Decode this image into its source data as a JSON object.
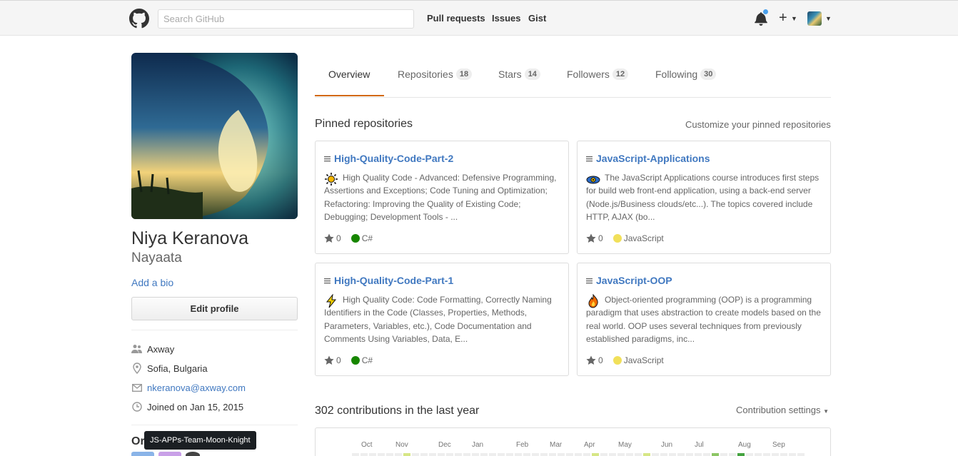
{
  "header": {
    "search_placeholder": "Search GitHub",
    "nav": [
      "Pull requests",
      "Issues",
      "Gist"
    ]
  },
  "profile": {
    "full_name": "Niya Keranova",
    "username": "Nayaata",
    "add_bio": "Add a bio",
    "edit_profile": "Edit profile",
    "details": {
      "company": "Axway",
      "location": "Sofia, Bulgaria",
      "email": "nkeranova@axway.com",
      "joined": "Joined on Jan 15, 2015"
    },
    "organizations_title": "Organizations",
    "tooltip": "JS-APPs-Team-Moon-Knight"
  },
  "tabs": [
    {
      "label": "Overview",
      "count": ""
    },
    {
      "label": "Repositories",
      "count": "18"
    },
    {
      "label": "Stars",
      "count": "14"
    },
    {
      "label": "Followers",
      "count": "12"
    },
    {
      "label": "Following",
      "count": "30"
    }
  ],
  "pinned": {
    "title": "Pinned repositories",
    "customize": "Customize your pinned repositories",
    "repos": [
      {
        "name": "High-Quality-Code-Part-2",
        "emoji": "sun-emoji",
        "description": "High Quality Code - Advanced: Defensive Programming, Assertions and Exceptions; Code Tuning and Optimization; Refactoring: Improving the Quality of Existing Code; Debugging; Development Tools - ...",
        "stars": "0",
        "language": "C#",
        "language_color": "#178600"
      },
      {
        "name": "JavaScript-Applications",
        "emoji": "eye-emoji",
        "description": "The JavaScript Applications course introduces first steps for build web front-end application, using a back-end server (Node.js/Business clouds/etc...). The topics covered include HTTP, AJAX (bo...",
        "stars": "0",
        "language": "JavaScript",
        "language_color": "#f1e05a"
      },
      {
        "name": "High-Quality-Code-Part-1",
        "emoji": "zap-emoji",
        "description": "High Quality Code: Code Formatting, Correctly Naming Identifiers in the Code (Classes, Properties, Methods, Parameters, Variables, etc.), Code Documentation and Comments Using Variables, Data, E...",
        "stars": "0",
        "language": "C#",
        "language_color": "#178600"
      },
      {
        "name": "JavaScript-OOP",
        "emoji": "fire-emoji",
        "description": "Object-oriented programming (OOP) is a programming paradigm that uses abstraction to create models based on the real world. OOP uses several techniques from previously established paradigms, inc...",
        "stars": "0",
        "language": "JavaScript",
        "language_color": "#f1e05a"
      }
    ]
  },
  "contributions": {
    "title": "302 contributions in the last year",
    "settings": "Contribution settings",
    "months": [
      "Oct",
      "Nov",
      "Dec",
      "Jan",
      "Feb",
      "Mar",
      "Apr",
      "May",
      "Jun",
      "Jul",
      "Aug",
      "Sep"
    ]
  }
}
